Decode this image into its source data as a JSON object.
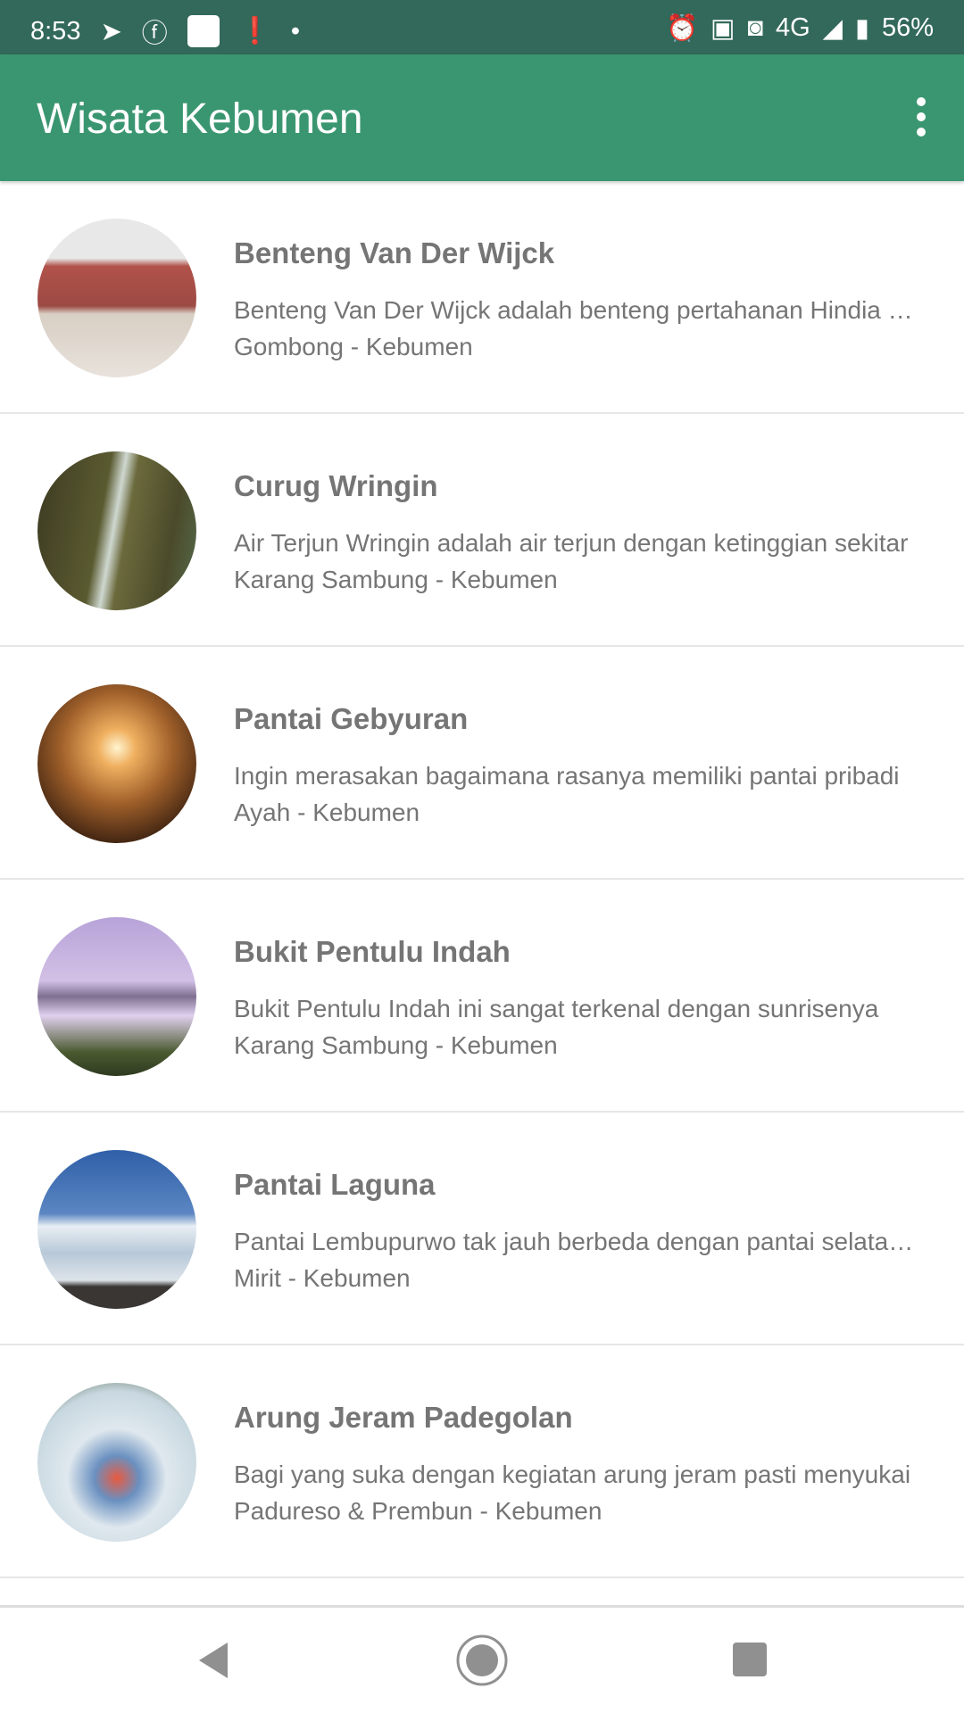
{
  "status": {
    "time": "8:53",
    "network": "4G",
    "battery": "56%"
  },
  "app": {
    "title": "Wisata Kebumen"
  },
  "items": [
    {
      "title": "Benteng Van Der Wijck",
      "desc": "Benteng Van Der Wijck adalah benteng pertahanan Hindia Belanda",
      "loc": "Gombong - Kebumen",
      "img": "linear-gradient(#e8e8e8 0%,#e8e8e8 25%,#b0524a 30%,#9c4a44 55%,#d8cfc4 60%,#e8e2dc 100%)"
    },
    {
      "title": "Curug Wringin",
      "desc": "Air Terjun Wringin adalah air terjun dengan ketinggian sekitar",
      "loc": "Karang Sambung - Kebumen",
      "img": "linear-gradient(100deg,#3d3a22 0%,#5a5a30 40%,#cfd8d0 48%,#6b6a3c 55%,#4b4a2a 80%,#556b4c 100%)"
    },
    {
      "title": "Pantai Gebyuran",
      "desc": "Ingin merasakan bagaimana rasanya memiliki pantai pribadi",
      "loc": "Ayah - Kebumen",
      "img": "radial-gradient(circle at 50% 40%,#fff4d0 0%,#f0b060 15%,#a0602a 45%,#3a2010 80%)"
    },
    {
      "title": "Bukit Pentulu Indah",
      "desc": "Bukit Pentulu Indah ini sangat terkenal dengan sunrisenya",
      "loc": "Karang Sambung - Kebumen",
      "img": "linear-gradient(#b7a3d8 0%,#d2c0e6 40%,#7f7090 50%,#e0d0ee 62%,#4a5a30 85%,#2f3a20 100%)"
    },
    {
      "title": "Pantai Laguna",
      "desc": "Pantai Lembupurwo tak jauh berbeda dengan pantai selatan lainnya",
      "loc": "Mirit - Kebumen",
      "img": "linear-gradient(#2f5fa8 0%,#5b86c2 40%,#e8eef4 48%,#b8c8d8 65%,#dde4ea 82%,#3a3634 86%,#3a3634 100%)"
    },
    {
      "title": "Arung Jeram Padegolan",
      "desc": "Bagi yang suka dengan kegiatan arung jeram pasti menyukai",
      "loc": "Padureso & Prembun - Kebumen",
      "img": "radial-gradient(circle at 50% 60%,#e85a40 0%,#6a90c0 18%,#dfe8ee 40%,#c8d8e0 70%,#3a4a2a 100%)"
    }
  ]
}
